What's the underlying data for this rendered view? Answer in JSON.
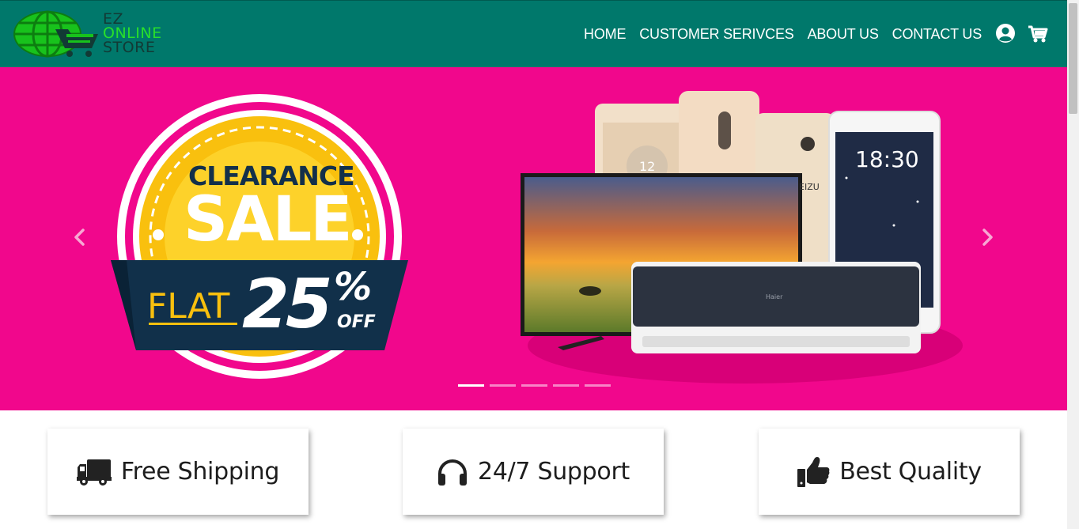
{
  "brand": {
    "line1": "EZ",
    "line2": "ONLINE",
    "line3": "STORE",
    "colors": {
      "green": "#28e02b",
      "dark": "#123a35"
    }
  },
  "nav": {
    "items": [
      {
        "label": "HOME"
      },
      {
        "label": "CUSTOMER SERIVCES"
      },
      {
        "label": "ABOUT US"
      },
      {
        "label": "CONTACT US"
      }
    ],
    "icons": [
      "user-icon",
      "cart-icon"
    ],
    "background": "#00786b"
  },
  "hero": {
    "background": "#f1078c",
    "badge": {
      "top": "CLEARANCE",
      "main": "SALE",
      "flat": "FLAT",
      "amount": "25",
      "percent": "%",
      "off": "OFF"
    },
    "screen": {
      "phone_time": "18:30",
      "phone_clock": "12",
      "phone_brand": "EIZU",
      "ac_brand": "Haier"
    },
    "slides": 5,
    "active_slide": 1
  },
  "features": [
    {
      "label": "Free Shipping",
      "icon": "truck-icon"
    },
    {
      "label": "24/7 Support",
      "icon": "headphones-icon"
    },
    {
      "label": "Best Quality",
      "icon": "thumbs-up-icon"
    }
  ]
}
